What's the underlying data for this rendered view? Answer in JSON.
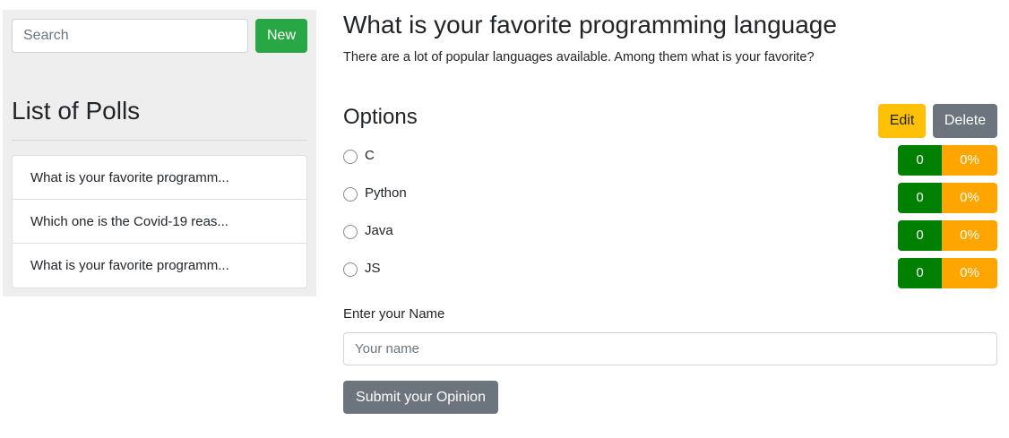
{
  "sidebar": {
    "search": {
      "placeholder": "Search",
      "value": ""
    },
    "new_label": "New",
    "list_title": "List of Polls",
    "polls": [
      "What is your favorite programm...",
      "Which one is the Covid-19 reas...",
      "What is your favorite programm..."
    ]
  },
  "poll": {
    "title": "What is your favorite programming language",
    "description": "There are a lot of popular languages available. Among them what is your favorite?",
    "options_heading": "Options",
    "edit_label": "Edit",
    "delete_label": "Delete",
    "options": [
      {
        "label": "C",
        "count": "0",
        "percent": "0%"
      },
      {
        "label": "Python",
        "count": "0",
        "percent": "0%"
      },
      {
        "label": "Java",
        "count": "0",
        "percent": "0%"
      },
      {
        "label": "JS",
        "count": "0",
        "percent": "0%"
      }
    ]
  },
  "form": {
    "name_label": "Enter your Name",
    "name_placeholder": "Your name",
    "name_value": "",
    "submit_label": "Submit your Opinion"
  },
  "colors": {
    "sidebar_bg": "#eeeeee",
    "new_button": "#28a745",
    "edit_button": "#ffc107",
    "delete_button": "#6c757d",
    "vote_count": "#008000",
    "vote_percent": "#ffa500",
    "submit_button": "#6c757d"
  }
}
